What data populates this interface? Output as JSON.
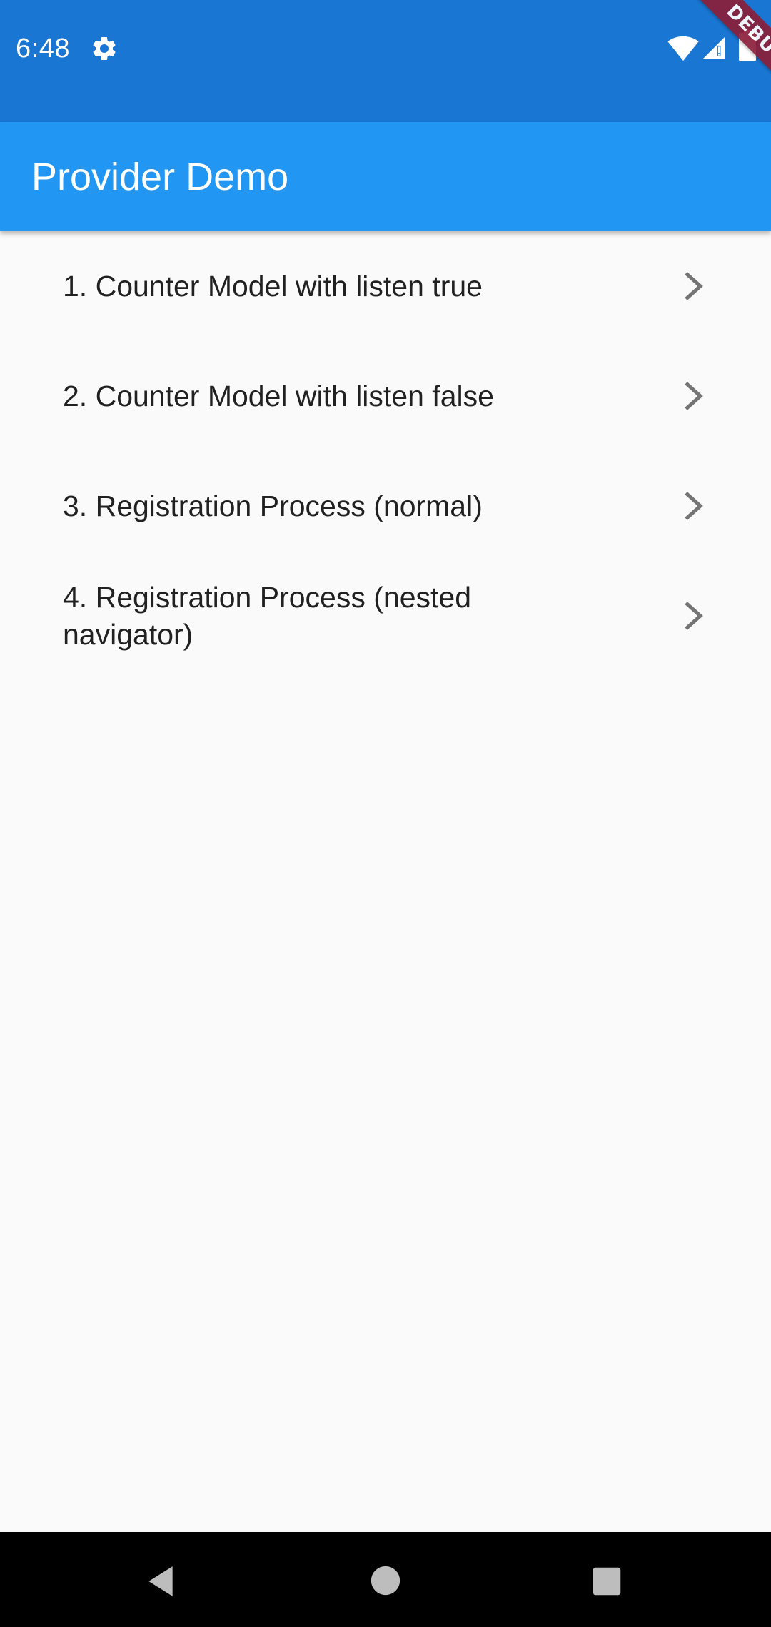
{
  "status_bar": {
    "time": "6:48",
    "background": "#1976d2",
    "icons": [
      "gear-icon",
      "wifi-icon",
      "signal-icon",
      "battery-icon"
    ]
  },
  "debug_banner": {
    "label": "DEBUG",
    "color": "#8b1f3a"
  },
  "app_bar": {
    "title": "Provider Demo",
    "background": "#2196f3"
  },
  "list": {
    "items": [
      {
        "label": "1. Counter Model with listen true",
        "icon": "chevron-right-icon"
      },
      {
        "label": "2. Counter Model with listen false",
        "icon": "chevron-right-icon"
      },
      {
        "label": "3. Registration Process (normal)",
        "icon": "chevron-right-icon"
      },
      {
        "label": "4. Registration Process (nested navigator)",
        "icon": "chevron-right-icon"
      }
    ]
  },
  "nav_bar": {
    "icons": [
      "back-icon",
      "home-icon",
      "recents-icon"
    ]
  }
}
